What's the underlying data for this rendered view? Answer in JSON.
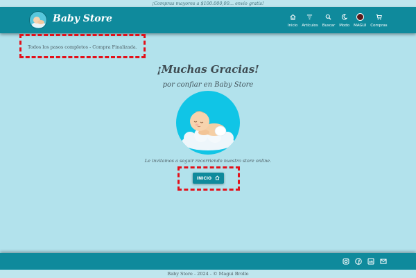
{
  "promo_banner": "¡Compras mayores a $100.000,00... envío gratis!",
  "brand": {
    "name": "Baby Store"
  },
  "nav": {
    "items": [
      {
        "label": "Inicio",
        "icon": "home-icon"
      },
      {
        "label": "Artículos",
        "icon": "filter-icon"
      },
      {
        "label": "Buscar",
        "icon": "search-icon"
      },
      {
        "label": "Modo",
        "icon": "moon-icon"
      },
      {
        "label": "MAGUI",
        "icon": "avatar-icon"
      },
      {
        "label": "Compras",
        "icon": "cart-icon"
      }
    ]
  },
  "status": {
    "message": "Todos los pasos completos - Compra Finalizada."
  },
  "thanks": {
    "title": "¡Muchas Gracias!",
    "subtitle": "por confiar en Baby Store",
    "invite": "Le invitamos a seguir recorriendo nuestro store online."
  },
  "cta": {
    "label": "INICIO",
    "icon": "home-icon"
  },
  "footer": {
    "social": [
      "instagram-icon",
      "facebook-icon",
      "linkedin-icon",
      "mail-icon"
    ],
    "copyright": "Baby Store - 2024 - © Magui Brollo"
  },
  "colors": {
    "background": "#b2e2ec",
    "primary": "#0f8a9c",
    "highlight": "#e3101a"
  }
}
